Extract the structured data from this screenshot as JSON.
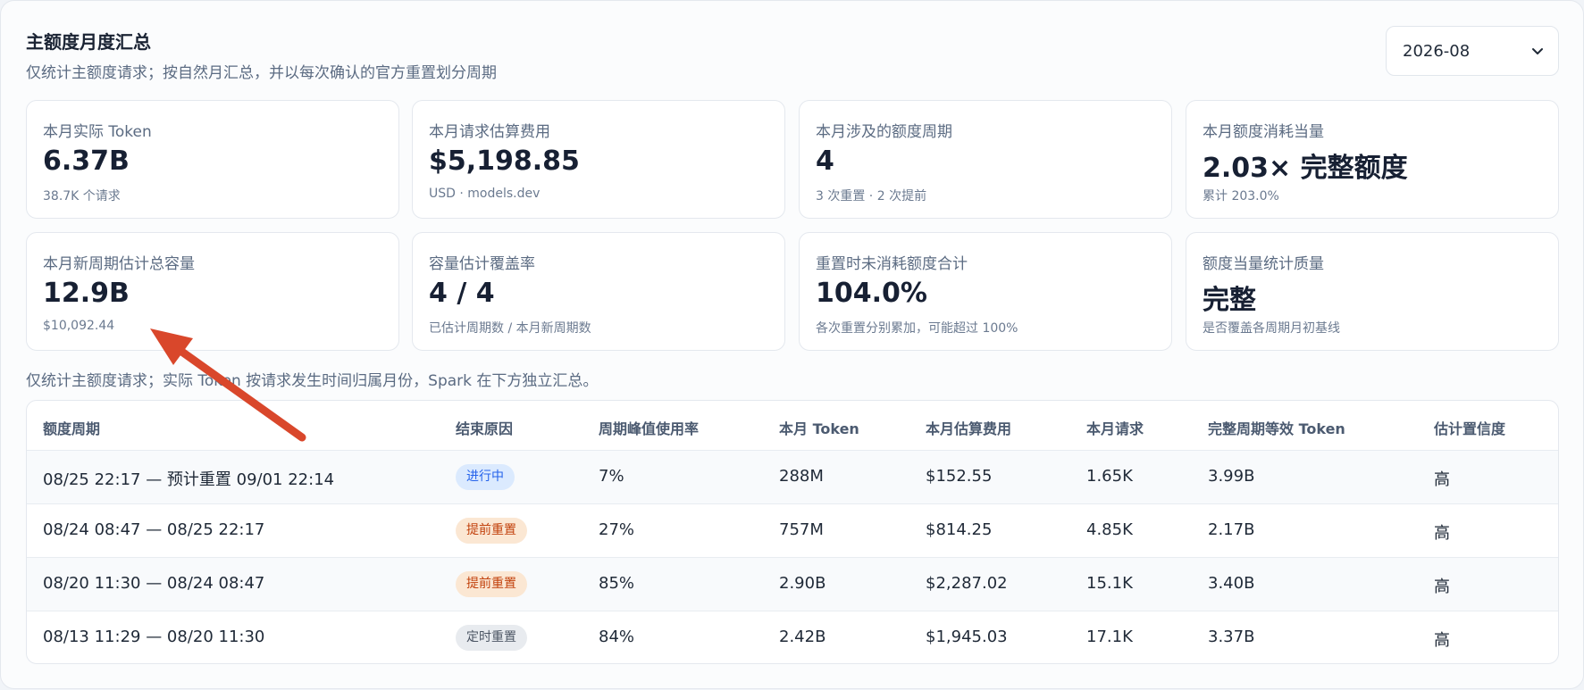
{
  "header": {
    "title": "主额度月度汇总",
    "subtitle": "仅统计主额度请求；按自然月汇总，并以每次确认的官方重置划分周期",
    "month": "2026-08"
  },
  "cards": [
    {
      "label": "本月实际 Token",
      "value": "6.37B",
      "sub": "38.7K 个请求"
    },
    {
      "label": "本月请求估算费用",
      "value": "$5,198.85",
      "sub": "USD · models.dev"
    },
    {
      "label": "本月涉及的额度周期",
      "value": "4",
      "sub": "3 次重置 · 2 次提前"
    },
    {
      "label": "本月额度消耗当量",
      "value": "2.03× 完整额度",
      "sub": "累计 203.0%"
    },
    {
      "label": "本月新周期估计总容量",
      "value": "12.9B",
      "sub": "$10,092.44"
    },
    {
      "label": "容量估计覆盖率",
      "value": "4 / 4",
      "sub": "已估计周期数 / 本月新周期数"
    },
    {
      "label": "重置时未消耗额度合计",
      "value": "104.0%",
      "sub": "各次重置分别累加，可能超过 100%"
    },
    {
      "label": "额度当量统计质量",
      "value": "完整",
      "sub": "是否覆盖各周期月初基线"
    }
  ],
  "note": "仅统计主额度请求；实际 Token 按请求发生时间归属月份，Spark 在下方独立汇总。",
  "table": {
    "headers": [
      "额度周期",
      "结束原因",
      "周期峰值使用率",
      "本月 Token",
      "本月估算费用",
      "本月请求",
      "完整周期等效 Token",
      "估计置信度"
    ],
    "rows": [
      {
        "period": "08/25 22:17 — 预计重置 09/01 22:14",
        "reason": "进行中",
        "reason_style": "blue",
        "peak": "7%",
        "tokens": "288M",
        "cost": "$152.55",
        "requests": "1.65K",
        "equiv": "3.99B",
        "confidence": "高"
      },
      {
        "period": "08/24 08:47 — 08/25 22:17",
        "reason": "提前重置",
        "reason_style": "orange",
        "peak": "27%",
        "tokens": "757M",
        "cost": "$814.25",
        "requests": "4.85K",
        "equiv": "2.17B",
        "confidence": "高"
      },
      {
        "period": "08/20 11:30 — 08/24 08:47",
        "reason": "提前重置",
        "reason_style": "orange",
        "peak": "85%",
        "tokens": "2.90B",
        "cost": "$2,287.02",
        "requests": "15.1K",
        "equiv": "3.40B",
        "confidence": "高"
      },
      {
        "period": "08/13 11:29 — 08/20 11:30",
        "reason": "定时重置",
        "reason_style": "gray",
        "peak": "84%",
        "tokens": "2.42B",
        "cost": "$1,945.03",
        "requests": "17.1K",
        "equiv": "3.37B",
        "confidence": "高"
      }
    ]
  },
  "colors": {
    "annotation_arrow": "#d9472b",
    "pill_blue": "#2563eb",
    "pill_orange": "#c2410c"
  }
}
